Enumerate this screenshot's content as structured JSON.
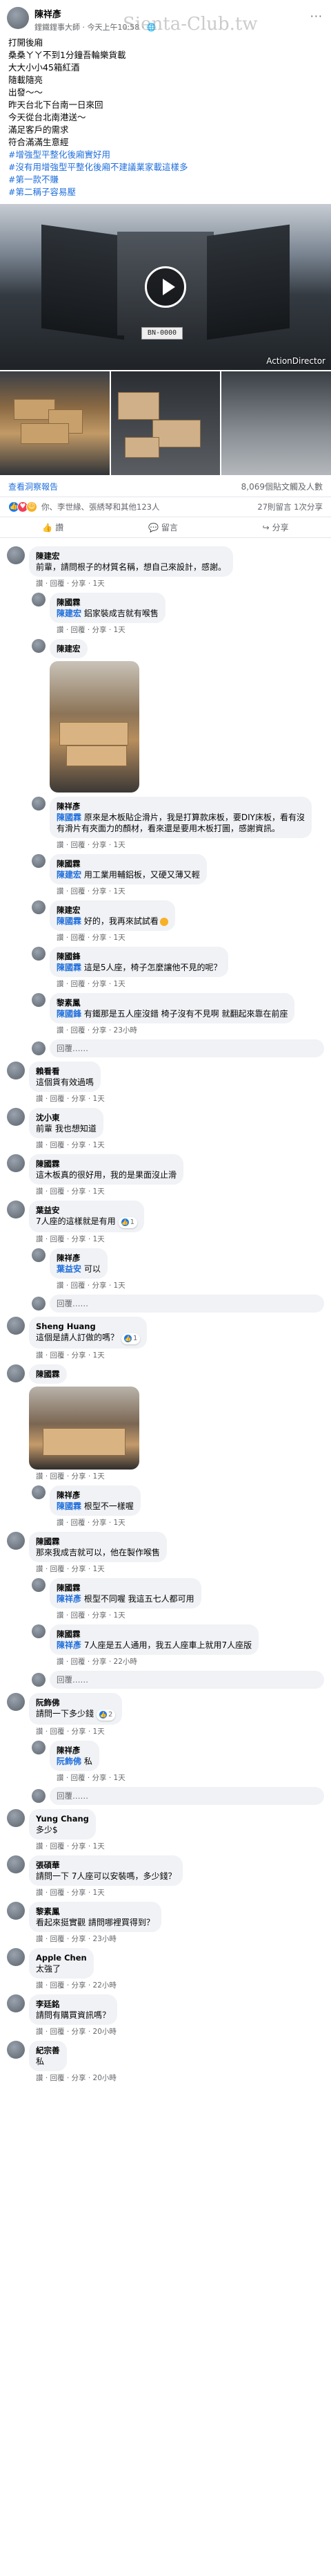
{
  "post": {
    "author": "陳祥彥",
    "meta": "鋰鐵鋰事大師 · 今天上午10:58 · 🌐",
    "more": "···",
    "watermark": "Sienta-Club.tw",
    "body_lines": [
      "打開後廂",
      "桑桑ㄚㄚ不到1分鐘吾輪樂貨載",
      "大大小小45箱紅酒",
      "隨載隨亮",
      "出發～～",
      "昨天台北下台南一日來回",
      "今天從台北南港送～",
      "滿足客戶的需求",
      "符合滿滿生意經"
    ],
    "tags": [
      "#增強型平整化後廂實好用",
      "#沒有用增強型平整化後廂不建議業家載這樣多",
      "#第一款不賺",
      "#第二稱子容易壓"
    ],
    "video_badge": "ActionDirector",
    "plate": "BN-0000",
    "insights_link": "查看洞察報告",
    "insights_count": "8,069個貼文觸及人數",
    "reactions_text": "你、李世緣、張綉琴和其他123人",
    "comments_count": "27則留言 1次分享",
    "actions": {
      "like": "讚",
      "comment": "留言",
      "share": "分享"
    }
  },
  "comments": [
    {
      "name": "陳建宏",
      "text": "前輩，請問根子的材質名稱，想自己來設計，感謝。",
      "actions": "讚 · 回覆 · 分享 · 1天"
    },
    {
      "name": "陳國霖",
      "mention": "陳建宏",
      "text": " 鋁家裝成吉就有喉售",
      "actions": "讚 · 回覆 · 分享 · 1天",
      "reply": true
    },
    {
      "name": "陳建宏",
      "text": "",
      "actions": "",
      "reply": true,
      "photo": true
    },
    {
      "name": "陳祥彥",
      "mention": "陳國霖",
      "text": " 原來是木板貼企滑片，我是打算款床板，要DIY床板，看有沒有滑片有夾面力的顏材，看來還是要用木板打圖，感謝資訊。",
      "actions": "讚 · 回覆 · 分享 · 1天",
      "reply": true
    },
    {
      "name": "陳國霖",
      "mention": "陳建宏",
      "text": " 用工業用輔鋁板，又硬又薄又輕",
      "actions": "讚 · 回覆 · 分享 · 1天",
      "reply": true
    },
    {
      "name": "陳建宏",
      "mention": "陳國霖",
      "text": " 好的，我再來試試看",
      "actions": "讚 · 回覆 · 分享 · 1天",
      "reply": true,
      "emoji": true
    },
    {
      "name": "陳國鋒",
      "mention": "陳國霖",
      "text": " 這是5人座，椅子怎麼讓他不見的呢？",
      "actions": "讚 · 回覆 · 分享 · 1天",
      "reply": true
    },
    {
      "name": "黎素鳳",
      "mention": "陳國鋒",
      "text": " 有鐵那是五人座沒錯 椅子沒有不見啊 就翻起來靠在前座",
      "actions": "讚 · 回覆 · 分享 · 23小時",
      "reply": true
    },
    {
      "name": "賴看看",
      "text": "這個貨有效過嗎",
      "actions": "讚 · 回覆 · 分享 · 1天"
    },
    {
      "name": "沈小東",
      "text": "前輩 我也想知道",
      "actions": "讚 · 回覆 · 分享 · 1天"
    },
    {
      "name": "陳國霖",
      "text": "這木板真的很好用，我的是果面沒止滑",
      "actions": "讚 · 回覆 · 分享 · 1天"
    },
    {
      "name": "葉益安",
      "text": "7人座的這樣就是有用",
      "actions": "讚 · 回覆 · 分享 · 1天",
      "badge": "1"
    },
    {
      "name": "陳祥彥",
      "mention": "葉益安",
      "text": " 可以",
      "actions": "讚 · 回覆 · 分享 · 1天",
      "reply": true
    },
    {
      "name": "Sheng Huang",
      "text": "這個是請人訂做的嗎？",
      "actions": "讚 · 回覆 · 分享 · 1天",
      "badge": "1"
    },
    {
      "name": "陳國霖",
      "text": "",
      "actions": "讚 · 回覆 · 分享 · 1天",
      "photo_wide": true
    },
    {
      "name": "陳祥彥",
      "mention": "陳國霖",
      "text": " 根型不一樣喔",
      "actions": "讚 · 回覆 · 分享 · 1天",
      "reply": true
    },
    {
      "name": "陳國霖",
      "text": "那來我成吉就可以，他在製作喉售",
      "actions": "讚 · 回覆 · 分享 · 1天"
    },
    {
      "name": "陳國霖",
      "mention": "陳祥彥",
      "text": " 根型不同喔 我這五七人都可用",
      "actions": "讚 · 回覆 · 分享 · 1天",
      "reply": true
    },
    {
      "name": "陳國霖",
      "mention": "陳祥彥",
      "text": " 7人座是五人通用，我五人座車上就用7人座版",
      "actions": "讚 · 回覆 · 分享 · 22小時",
      "reply": true
    },
    {
      "name": "阮飾佛",
      "text": "請問一下多少錢",
      "actions": "讚 · 回覆 · 分享 · 1天",
      "badge": "2"
    },
    {
      "name": "陳祥彥",
      "mention": "阮飾佛",
      "text": " 私",
      "actions": "讚 · 回覆 · 分享 · 1天",
      "reply": true
    },
    {
      "name": "Yung Chang",
      "text": "多少$",
      "actions": "讚 · 回覆 · 分享 · 1天"
    },
    {
      "name": "張碩華",
      "text": "請問一下 7人座可以安裝嗎，多少錢？",
      "actions": "讚 · 回覆 · 分享 · 1天"
    },
    {
      "name": "黎素鳳",
      "text": "看起來挺實觀 請問哪裡買得到？",
      "actions": "讚 · 回覆 · 分享 · 23小時"
    },
    {
      "name": "Apple Chen",
      "text": "太強了",
      "actions": "讚 · 回覆 · 分享 · 22小時"
    },
    {
      "name": "李廷銘",
      "text": "請問有購買資訊嗎？",
      "actions": "讚 · 回覆 · 分享 · 20小時"
    },
    {
      "name": "紀宗善",
      "text": "私",
      "actions": "讚 · 回覆 · 分享 · 20小時"
    }
  ],
  "reply_placeholder": "回覆……",
  "colors": {
    "link": "#216fdb",
    "bubble": "#f0f2f5",
    "like": "#1877f2"
  }
}
